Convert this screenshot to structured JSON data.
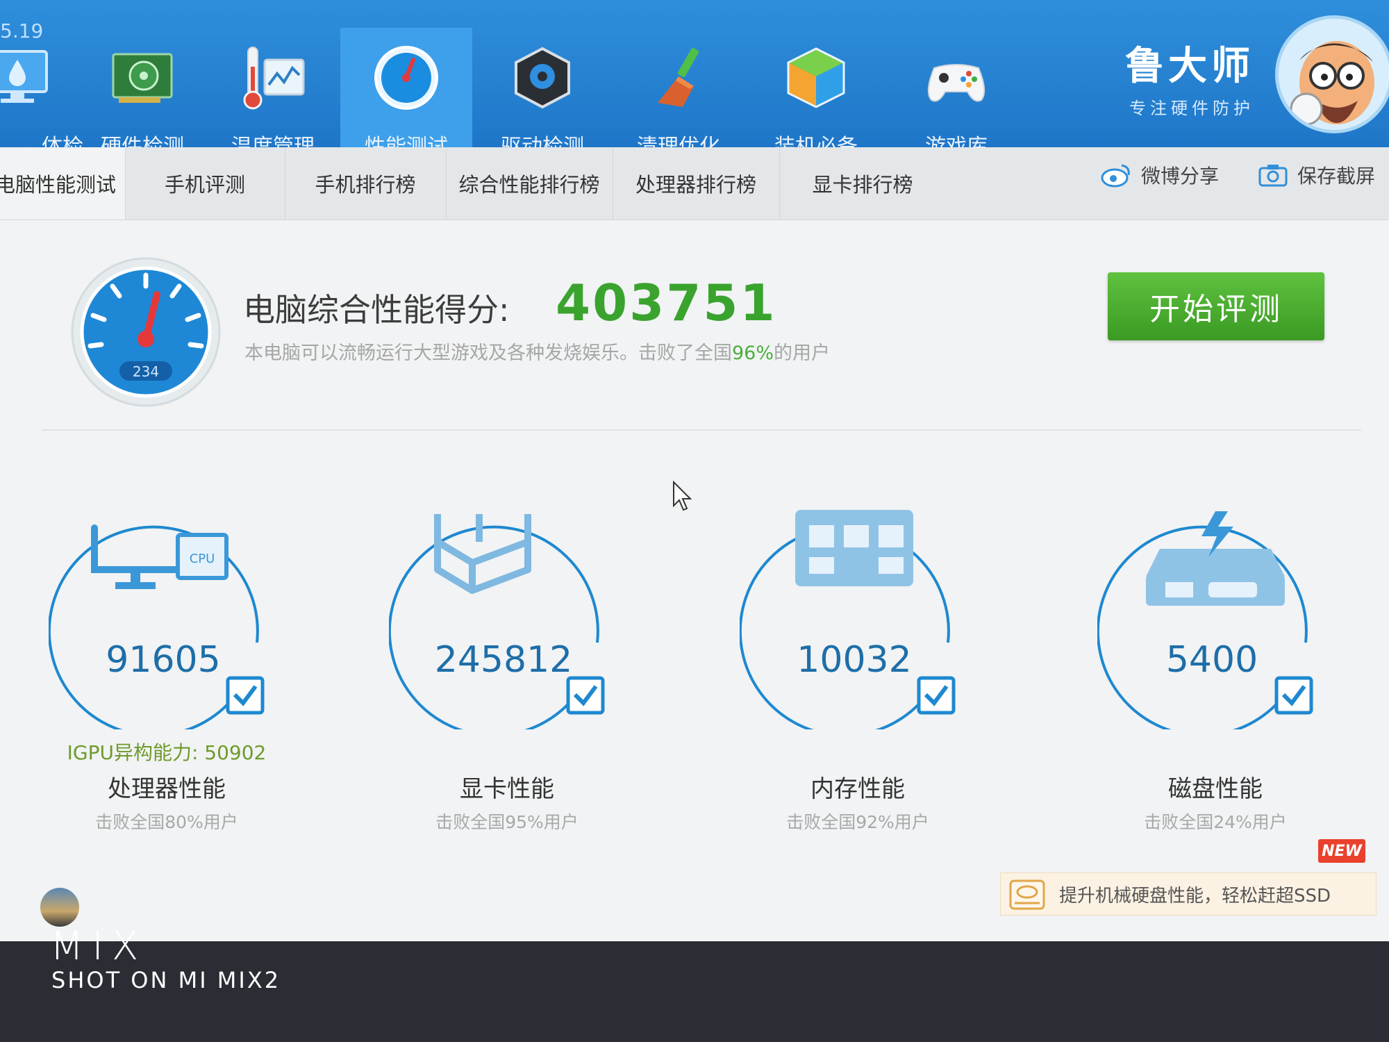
{
  "header": {
    "version": "5.19",
    "nav": [
      {
        "label": "体检",
        "icon": "monitor-drop-icon"
      },
      {
        "label": "硬件检测",
        "icon": "graphics-card-icon"
      },
      {
        "label": "温度管理",
        "icon": "thermometer-chart-icon"
      },
      {
        "label": "性能测试",
        "icon": "speedometer-icon",
        "active": true
      },
      {
        "label": "驱动检测",
        "icon": "driver-gear-icon"
      },
      {
        "label": "清理优化",
        "icon": "broom-icon"
      },
      {
        "label": "装机必备",
        "icon": "cube-icon"
      },
      {
        "label": "游戏库",
        "icon": "gamepad-icon"
      }
    ],
    "brand_name": "鲁大师",
    "brand_slogan": "专注硬件防护"
  },
  "tabs": [
    {
      "label": "电脑性能测试",
      "active": true
    },
    {
      "label": "手机评测"
    },
    {
      "label": "手机排行榜"
    },
    {
      "label": "综合性能排行榜"
    },
    {
      "label": "处理器排行榜"
    },
    {
      "label": "显卡排行榜"
    }
  ],
  "actions": {
    "weibo_share": "微博分享",
    "save_screenshot": "保存截屏"
  },
  "score": {
    "label": "电脑综合性能得分:",
    "value": "403751",
    "desc_prefix": "本电脑可以流畅运行大型游戏及各种发烧娱乐。击败了全国",
    "desc_pct": "96%",
    "desc_suffix": "的用户",
    "gauge_reading": "234",
    "start_button": "开始评测"
  },
  "metrics": [
    {
      "score": "91605",
      "igpu": "IGPU异构能力: 50902",
      "name": "处理器性能",
      "rank": "击败全国80%用户",
      "icon": "monitor-cpu-icon",
      "cpu_chip_label": "CPU"
    },
    {
      "score": "245812",
      "name": "显卡性能",
      "rank": "击败全国95%用户",
      "icon": "3d-cube-icon"
    },
    {
      "score": "10032",
      "name": "内存性能",
      "rank": "击败全国92%用户",
      "icon": "memory-chip-icon"
    },
    {
      "score": "5400",
      "name": "磁盘性能",
      "rank": "击败全国24%用户",
      "icon": "hard-disk-icon"
    }
  ],
  "promo": {
    "text": "提升机械硬盘性能，轻松赶超SSD",
    "badge": "NEW"
  },
  "watermark": {
    "brand": "MIX",
    "sub": "SHOT ON MI MIX2"
  },
  "colors": {
    "header_blue": "#1f76c8",
    "score_green": "#3aa32e",
    "ring_blue": "#1e88d0",
    "button_green": "#4aae2f",
    "badge_red": "#e9412d"
  }
}
